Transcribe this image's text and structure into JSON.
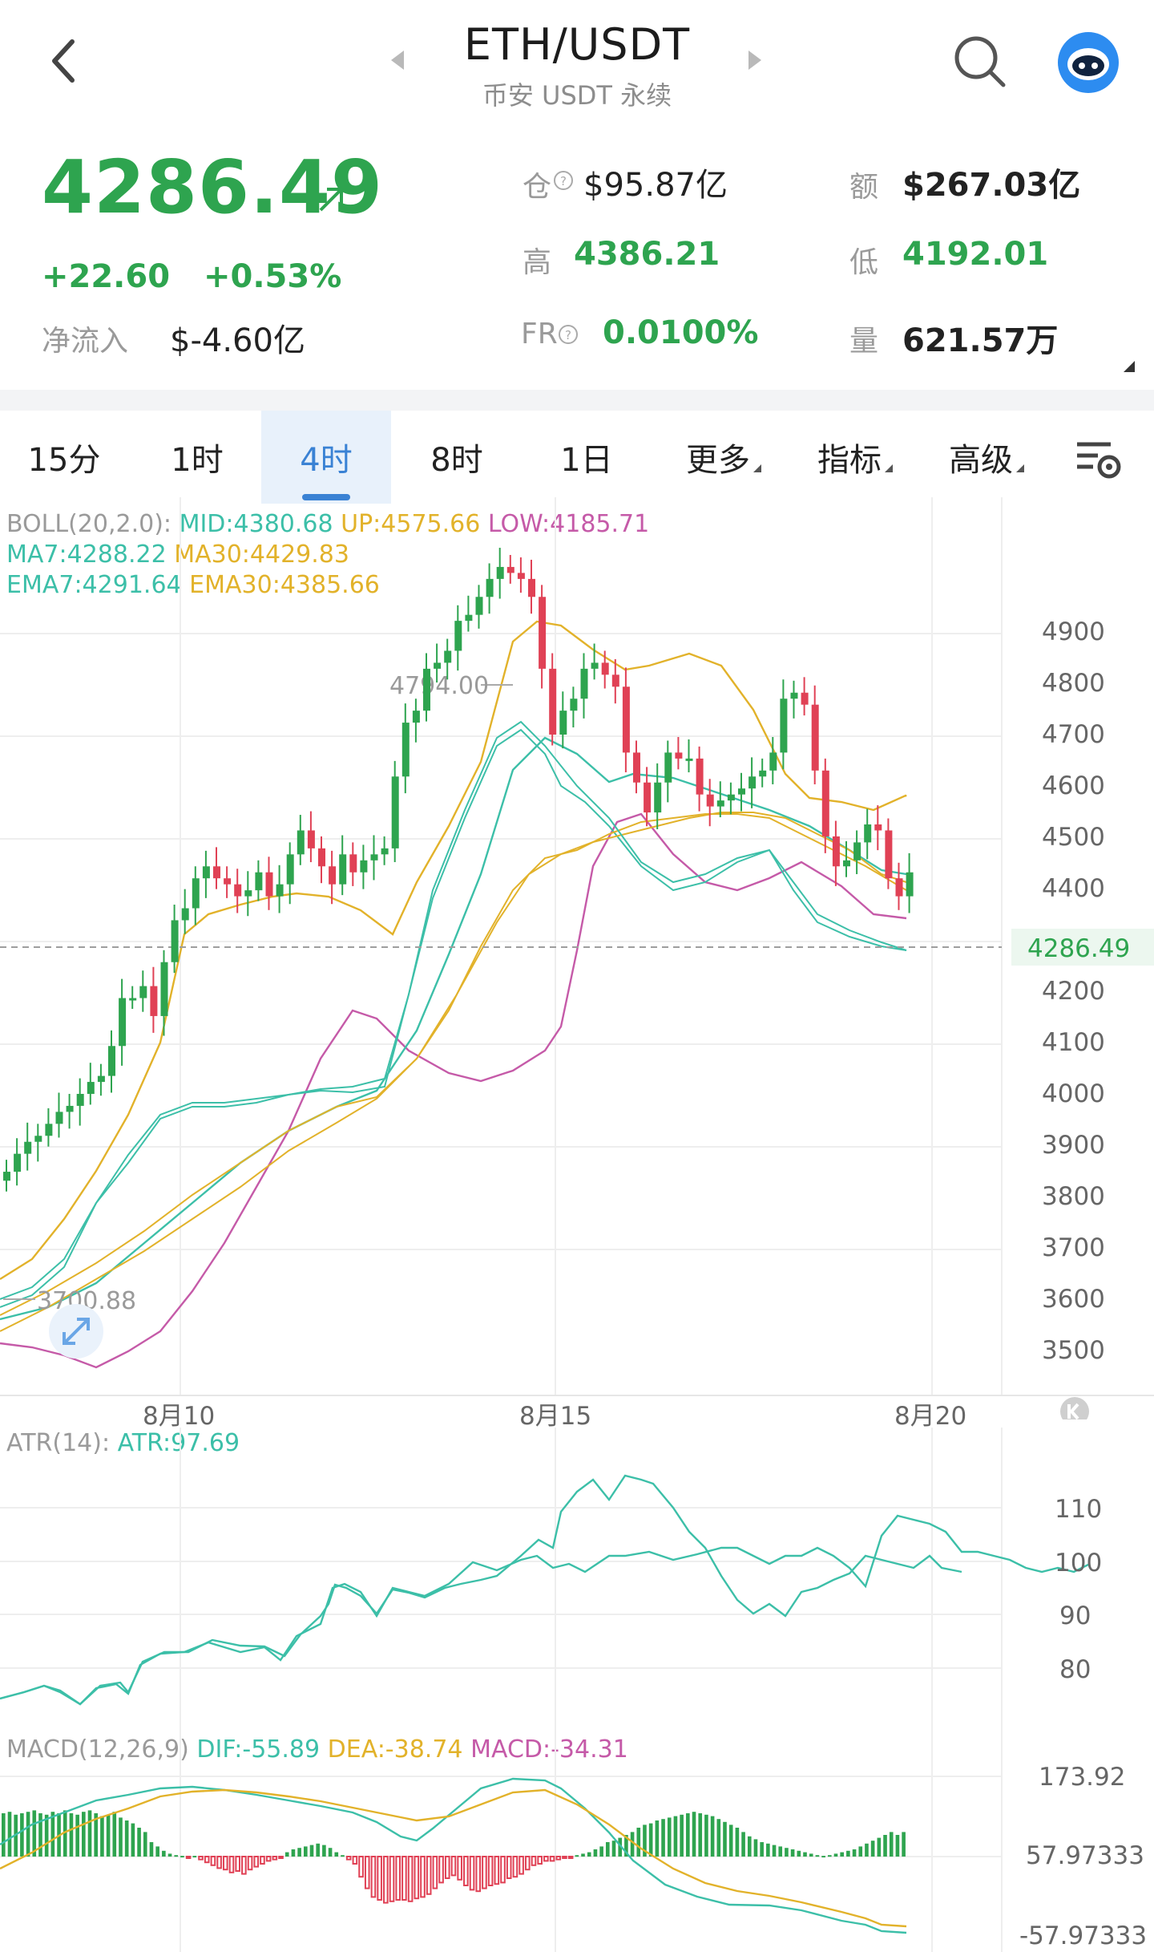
{
  "header": {
    "title": "ETH/USDT",
    "subtitle": "币安 USDT 永续"
  },
  "price": {
    "last": "4286.49",
    "change": "+22.60",
    "change_pct": "+0.53%",
    "netflow_label": "净流入",
    "netflow_value": "$-4.60亿"
  },
  "stats": {
    "oi_label": "仓",
    "oi_value": "$95.87亿",
    "turnover_label": "额",
    "turnover_value": "$267.03亿",
    "high_label": "高",
    "high_value": "4386.21",
    "low_label": "低",
    "low_value": "4192.01",
    "fr_label": "FR",
    "fr_value": "0.0100%",
    "vol_label": "量",
    "vol_value": "621.57万"
  },
  "tabs": [
    {
      "label": "15分"
    },
    {
      "label": "1时"
    },
    {
      "label": "4时"
    },
    {
      "label": "8时"
    },
    {
      "label": "1日"
    },
    {
      "label": "更多"
    },
    {
      "label": "指标"
    },
    {
      "label": "高级"
    }
  ],
  "active_tab": "4时",
  "indicators": {
    "boll_prefix": "BOLL(20,2.0):",
    "boll_mid": "MID:4380.68",
    "boll_up": "UP:4575.66",
    "boll_low": "LOW:4185.71",
    "ma7": "MA7:4288.22",
    "ma30": "MA30:4429.83",
    "ema7": "EMA7:4291.64",
    "ema30": "EMA30:4385.66"
  },
  "main_chart": {
    "y_ticks": [
      "4900",
      "4800",
      "4700",
      "4600",
      "4500",
      "4400",
      "4200",
      "4100",
      "4000",
      "3900",
      "3800",
      "3700",
      "3600",
      "3500"
    ],
    "current_price_tag": "4286.49",
    "high_marker": "4794.00",
    "low_marker": "3700.88",
    "x_ticks": [
      "8月10",
      "8月15",
      "8月20"
    ]
  },
  "atr": {
    "label_prefix": "ATR(14):",
    "label_value": "ATR:97.69",
    "y_ticks": [
      "110",
      "100",
      "90",
      "80"
    ]
  },
  "macd": {
    "label_prefix": "MACD(12,26,9)",
    "dif": "DIF:-55.89",
    "dea": "DEA:-38.74",
    "macd": "MACD:-34.31",
    "y_ticks": [
      "173.92",
      "57.97333",
      "-57.97333"
    ]
  },
  "colors": {
    "up": "#2ea44f",
    "down": "#e04155",
    "mid": "#3cbfa8",
    "upper": "#e2b22a",
    "lower": "#c55aa8",
    "accent": "#3a82d4"
  },
  "chart_data": {
    "type": "candlestick",
    "timeframe": "4h",
    "y_range": [
      3450,
      4950
    ],
    "candles_close_approx": [
      3770,
      3800,
      3820,
      3830,
      3850,
      3870,
      3880,
      3900,
      3920,
      3930,
      3980,
      4060,
      4060,
      4080,
      4030,
      4120,
      4190,
      4210,
      4260,
      4280,
      4260,
      4250,
      4230,
      4240,
      4270,
      4230,
      4250,
      4300,
      4340,
      4310,
      4280,
      4250,
      4300,
      4270,
      4290,
      4300,
      4310,
      4430,
      4520,
      4540,
      4610,
      4620,
      4640,
      4690,
      4700,
      4730,
      4760,
      4780,
      4770,
      4760,
      4730,
      4610,
      4500,
      4540,
      4560,
      4610,
      4620,
      4600,
      4580,
      4470,
      4420,
      4370,
      4420,
      4470,
      4460,
      4460,
      4400,
      4380,
      4390,
      4400,
      4410,
      4430,
      4440,
      4470,
      4560,
      4570,
      4550,
      4440,
      4330,
      4280,
      4290,
      4320,
      4350,
      4340,
      4260,
      4230,
      4270
    ]
  }
}
